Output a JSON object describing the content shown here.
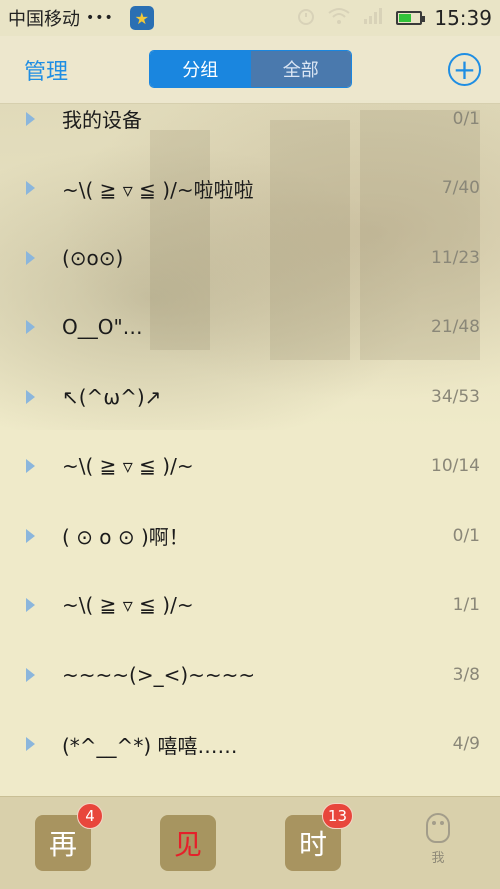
{
  "status": {
    "carrier": "中国移动",
    "dots": "•••",
    "time": "15:39",
    "battery_level": 0.6
  },
  "nav": {
    "manage": "管理",
    "tabs": [
      "分组",
      "全部"
    ],
    "active_tab": "分组",
    "add": "+"
  },
  "groups": [
    {
      "name": "我的设备",
      "count": "0/1"
    },
    {
      "name": "~\\( ≧ ▿ ≦ )/~啦啦啦",
      "count": "7/40"
    },
    {
      "name": "(⊙o⊙)",
      "count": "11/23"
    },
    {
      "name": "O__O\"…",
      "count": "21/48"
    },
    {
      "name": "↖(^ω^)↗",
      "count": "34/53"
    },
    {
      "name": "~\\( ≧ ▿ ≦ )/~",
      "count": "10/14"
    },
    {
      "name": "( ⊙ o ⊙ )啊！",
      "count": "0/1"
    },
    {
      "name": "~\\( ≧ ▿ ≦ )/~",
      "count": "1/1"
    },
    {
      "name": "~~~~(>_<)~~~~",
      "count": "3/8"
    },
    {
      "name": "(*^__^*) 嘻嘻……",
      "count": "4/9"
    }
  ],
  "tabbar": {
    "tab1": {
      "label": "再",
      "badge": "4"
    },
    "tab2": {
      "label": "见"
    },
    "tab3": {
      "label": "时",
      "badge": "13"
    },
    "me": {
      "label": "我"
    }
  },
  "colors": {
    "accent": "#1a86df",
    "badge": "#e8463c",
    "background": "#efeac9"
  }
}
